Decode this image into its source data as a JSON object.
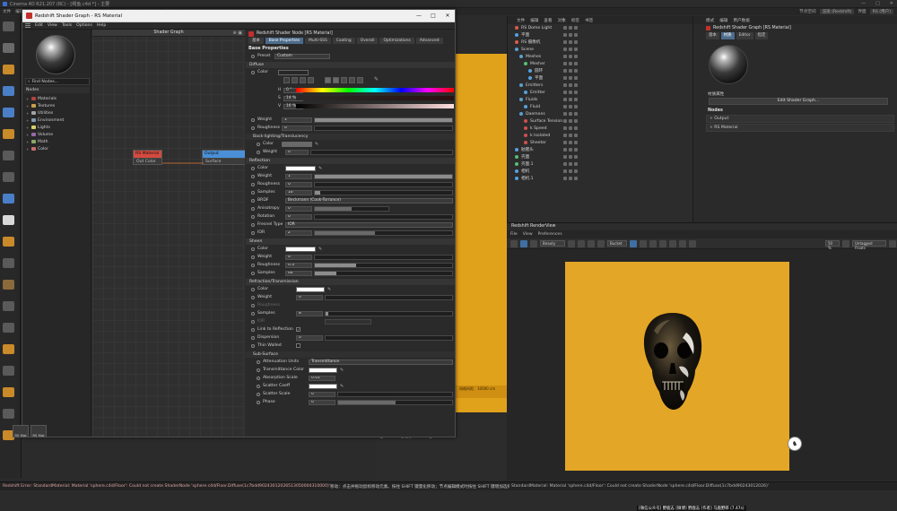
{
  "app": {
    "title": "Cinema 4D R21.207 (RC) - [鳄鱼.c4d *] - 主要",
    "menu": [
      "文件",
      "编辑",
      "创建",
      "模式",
      "选择",
      "工具",
      "网格",
      "样条",
      "体积",
      "运动图形",
      "角色",
      "动画",
      "模拟",
      "跟踪器",
      "渲染",
      "扩展",
      "窗口",
      "帮助",
      "Redshift"
    ],
    "top_right": {
      "node_space_label": "节点空间",
      "node_space_value": "渲染 (Redshift)",
      "layout_label": "界面",
      "layout_value": "RS (用户)"
    }
  },
  "shader_window": {
    "title": "Redshift Shader Graph - RS Material",
    "menu": [
      "Edit",
      "View",
      "Tools",
      "Options",
      "Help"
    ],
    "find_placeholder": "Find Nodes...",
    "nodes_header": "Nodes",
    "tree": [
      {
        "label": "Materials",
        "color": "#b0453c"
      },
      {
        "label": "Textures",
        "color": "#c9a04a"
      },
      {
        "label": "Utilities",
        "color": "#a3a3a3"
      },
      {
        "label": "Environment",
        "color": "#7f9ab0"
      },
      {
        "label": "Lights",
        "color": "#d9d06a"
      },
      {
        "label": "Volume",
        "color": "#9966aa"
      },
      {
        "label": "Math",
        "color": "#8aa966"
      },
      {
        "label": "Color",
        "color": "#c86d6d"
      }
    ],
    "graph_title": "Shader Graph",
    "node_rs_material": {
      "title": "RS Material",
      "port": "Out Color",
      "color": "#d44a3f"
    },
    "node_output": {
      "title": "Output",
      "port": "Surface",
      "color": "#4a8fd8"
    },
    "bottom_tabs": [
      "RS Mat",
      "RS Mat"
    ]
  },
  "props": {
    "header": "Redshift Shader Node [RS Material]",
    "tabs": [
      "基本",
      "Base Properties",
      "Multi-SSS",
      "Coating",
      "Overall",
      "Optimizations",
      "Advanced"
    ],
    "active_tab": "Base Properties",
    "section_base": "Base Properties",
    "preset_label": "Preset",
    "preset_value": "Custom",
    "diffuse": {
      "title": "Diffuse",
      "color_label": "Color",
      "h_label": "H",
      "h_value": "0 °",
      "s_label": "S",
      "s_value": "14 %",
      "v_label": "V",
      "v_value": "16 %",
      "weight_label": "Weight",
      "weight_value": "1",
      "roughness_label": "Roughness",
      "roughness_value": "0",
      "color": "#282626"
    },
    "backlight": {
      "title": "Back-lighting/Translucency",
      "color_label": "Color",
      "weight_label": "Weight",
      "weight_value": "0",
      "color": "#6a6a6a"
    },
    "reflection": {
      "title": "Reflection",
      "color_label": "Color",
      "color": "#ffffff",
      "weight_label": "Weight",
      "weight_value": "1",
      "roughness_label": "Roughness",
      "roughness_value": "0",
      "samples_label": "Samples",
      "samples_value": "16",
      "brdf_label": "BRDF",
      "brdf_value": "Beckmann (Cook-Torrance)",
      "anisotropy_label": "Anisotropy",
      "anisotropy_value": "0",
      "rotation_label": "Rotation",
      "rotation_value": "0",
      "fresnel_label": "Fresnel Type",
      "fresnel_value": "IOR",
      "ior_label": "IOR",
      "ior_value": "2"
    },
    "sheen": {
      "title": "Sheen",
      "color_label": "Color",
      "color": "#ffffff",
      "weight_label": "Weight",
      "weight_value": "0",
      "roughness_label": "Roughness",
      "roughness_value": "0.3",
      "samples_label": "Samples",
      "samples_value": "64"
    },
    "refraction": {
      "title": "Refraction/Transmission",
      "color_label": "Color",
      "color": "#ffffff",
      "weight_label": "Weight",
      "weight_value": "0",
      "roughness_label": "Roughness",
      "samples_label": "Samples",
      "samples_value": "8",
      "ior_label": "IOR",
      "link_label": "Link to Reflection",
      "dispersion_label": "Dispersion",
      "dispersion_value": "0",
      "thin_label": "Thin Walled"
    },
    "subsurface": {
      "title": "Sub-Surface",
      "atten_label": "Attenuation Units",
      "atten_value": "Transmittance",
      "trans_label": "Transmittance Color",
      "trans_color": "#ffffff",
      "abs_label": "Absorption Scale",
      "abs_value": "0.01",
      "scatter_label": "Scatter Coeff",
      "scatter_color": "#ffffff",
      "scatter_scale_label": "Scatter Scale",
      "scatter_scale_value": "0",
      "phase_label": "Phase",
      "phase_value": "0"
    }
  },
  "object_manager": {
    "menu": [
      "文件",
      "编辑",
      "查看",
      "对象",
      "标签",
      "书签"
    ],
    "rows": [
      {
        "label": "RS Dome Light",
        "indent": 0,
        "dot": "#e05a4a"
      },
      {
        "label": "平面",
        "indent": 0,
        "dot": "#58a0e0"
      },
      {
        "label": "RS 摄像机",
        "indent": 0,
        "dot": "#e05a4a"
      },
      {
        "label": "Scene",
        "indent": 0,
        "dot": "#5aa0d0"
      },
      {
        "label": "Meshes",
        "indent": 1,
        "dot": "#5aa0d0"
      },
      {
        "label": "Mesher",
        "indent": 2,
        "dot": "#58c070"
      },
      {
        "label": "圆环",
        "indent": 3,
        "dot": "#58a0e0"
      },
      {
        "label": "平面",
        "indent": 3,
        "dot": "#58a0e0"
      },
      {
        "label": "Emitters",
        "indent": 1,
        "dot": "#5aa0d0"
      },
      {
        "label": "Emitter",
        "indent": 2,
        "dot": "#58a0e0"
      },
      {
        "label": "Fluids",
        "indent": 1,
        "dot": "#5aa0d0"
      },
      {
        "label": "Fluid",
        "indent": 2,
        "dot": "#58a0e0"
      },
      {
        "label": "Daemons",
        "indent": 1,
        "dot": "#5aa0d0"
      },
      {
        "label": "Surface Tension",
        "indent": 2,
        "dot": "#d05050"
      },
      {
        "label": "k Speed",
        "indent": 2,
        "dot": "#d05050"
      },
      {
        "label": "k Isolated",
        "indent": 2,
        "dot": "#d05050"
      },
      {
        "label": "Sheeter",
        "indent": 2,
        "dot": "#d05050"
      },
      {
        "label": "骷髅头",
        "indent": 0,
        "dot": "#58a0e0"
      },
      {
        "label": "壳面",
        "indent": 0,
        "dot": "#58c070"
      },
      {
        "label": "壳面.1",
        "indent": 0,
        "dot": "#58c070"
      },
      {
        "label": "相机",
        "indent": 0,
        "dot": "#58a0e0"
      },
      {
        "label": "相机.1",
        "indent": 0,
        "dot": "#58a0e0"
      }
    ]
  },
  "attributes": {
    "menu": [
      "模式",
      "编辑",
      "用户数据"
    ],
    "header": "Redshift Shader Graph [RS Material]",
    "tabs": [
      "基本",
      "材质",
      "Editor",
      "指定"
    ],
    "active_tab": "材质",
    "section_label": "材质属性",
    "edit_button": "Edit Shader Graph...",
    "nodes_header": "Nodes",
    "node_rows": [
      "+ Output",
      "+ RS Material"
    ]
  },
  "renderview": {
    "title": "Redshift RenderView",
    "menu": [
      "File",
      "View",
      "Preferences"
    ],
    "mode": "Beauty",
    "zoom": "Bucket",
    "percent": "50 %",
    "display": "Untagged Floats",
    "caption": "[微信公众号] 野鹿志  [微博] 野鹿志  [作者] 马鹿野郎  (7.47s)",
    "image_bg": "#e4a626"
  },
  "viewport": {
    "grid_label": "网格间距：10000 cm"
  },
  "status": {
    "left": "Redshift Error: StandardMaterial: Material 'sphere.c4d/Floor': Could not create ShaderNode 'sphere.c4d/Floor.Diffuse(1c7bdd90243012026513050004310000)'",
    "middle": "移动：点击并拖动鼠标移动元素。按住 SHIFT 键量化移动；节点编辑模式时按住 SHIFT 键增加选择对象；按住 CTRL 键减少选择对象。",
    "right": "StandardMaterial: Material 'sphere.c4d/Floor': Could not create ShaderNode 'sphere.c4d/Floor.Diffuse(1c7bdd90243012026)'"
  }
}
